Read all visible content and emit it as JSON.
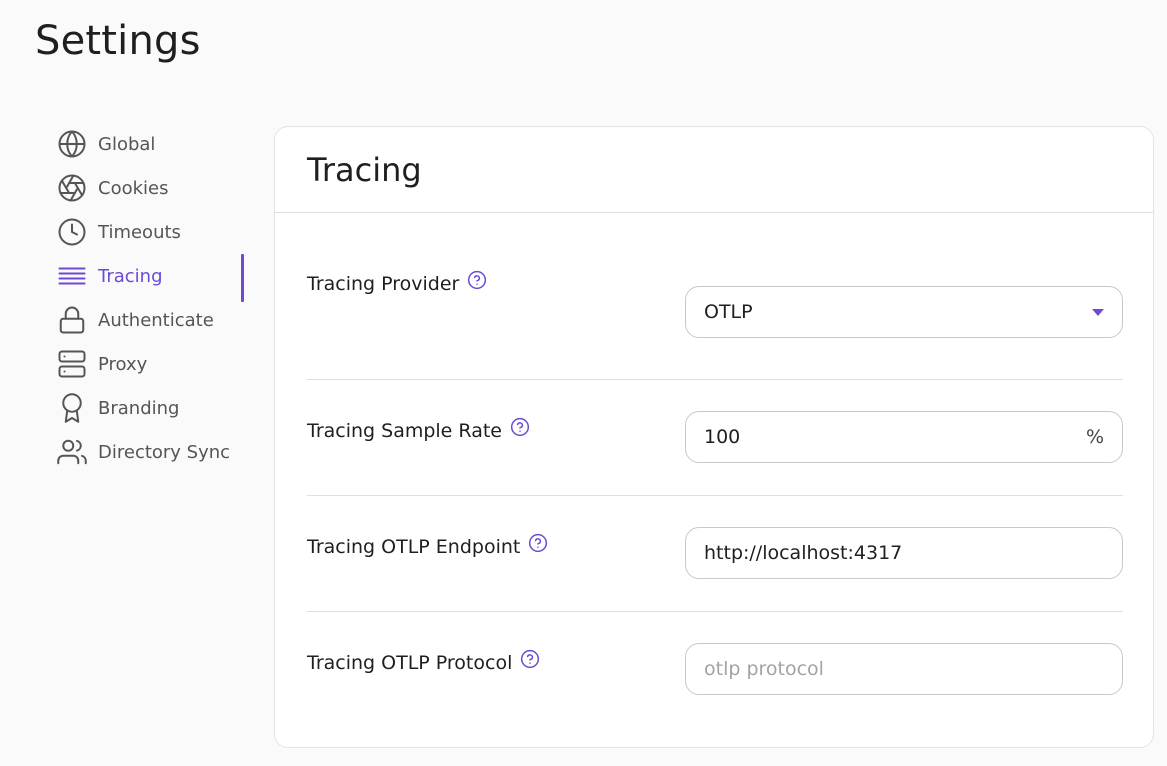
{
  "page": {
    "title": "Settings"
  },
  "sidebar": {
    "items": [
      {
        "label": "Global",
        "icon": "globe-icon"
      },
      {
        "label": "Cookies",
        "icon": "aperture-icon"
      },
      {
        "label": "Timeouts",
        "icon": "clock-icon"
      },
      {
        "label": "Tracing",
        "icon": "lines-icon",
        "active": true
      },
      {
        "label": "Authenticate",
        "icon": "lock-icon"
      },
      {
        "label": "Proxy",
        "icon": "server-icon"
      },
      {
        "label": "Branding",
        "icon": "award-icon"
      },
      {
        "label": "Directory Sync",
        "icon": "users-icon"
      }
    ]
  },
  "card": {
    "title": "Tracing",
    "fields": {
      "provider": {
        "label": "Tracing Provider",
        "value": "OTLP"
      },
      "sample_rate": {
        "label": "Tracing Sample Rate",
        "value": "100",
        "suffix": "%"
      },
      "endpoint": {
        "label": "Tracing OTLP Endpoint",
        "value": "http://localhost:4317"
      },
      "protocol": {
        "label": "Tracing OTLP Protocol",
        "value": "",
        "placeholder": "otlp protocol"
      }
    }
  },
  "colors": {
    "accent": "#6c4ad3",
    "text": "#1f1f1f",
    "muted": "#555555",
    "border": "#c9c9c9"
  }
}
